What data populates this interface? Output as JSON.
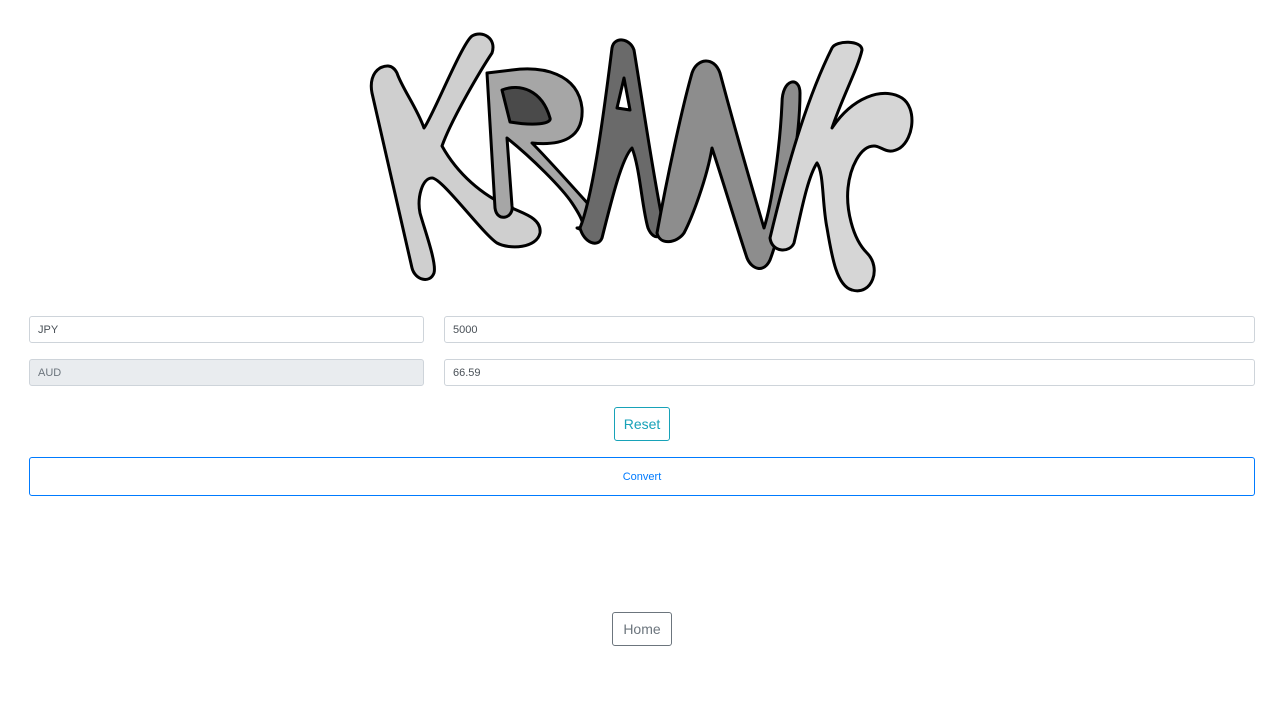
{
  "logo": {
    "alt_text": "KRANK"
  },
  "converter": {
    "from_currency": "JPY",
    "from_amount": "5000",
    "to_currency": "AUD",
    "to_amount": "66.59"
  },
  "buttons": {
    "reset_label": "Reset",
    "convert_label": "Convert",
    "home_label": "Home"
  },
  "colors": {
    "reset": "#17a2b8",
    "convert": "#007bff",
    "home": "#6c757d",
    "readonly_bg": "#e9ecef"
  }
}
